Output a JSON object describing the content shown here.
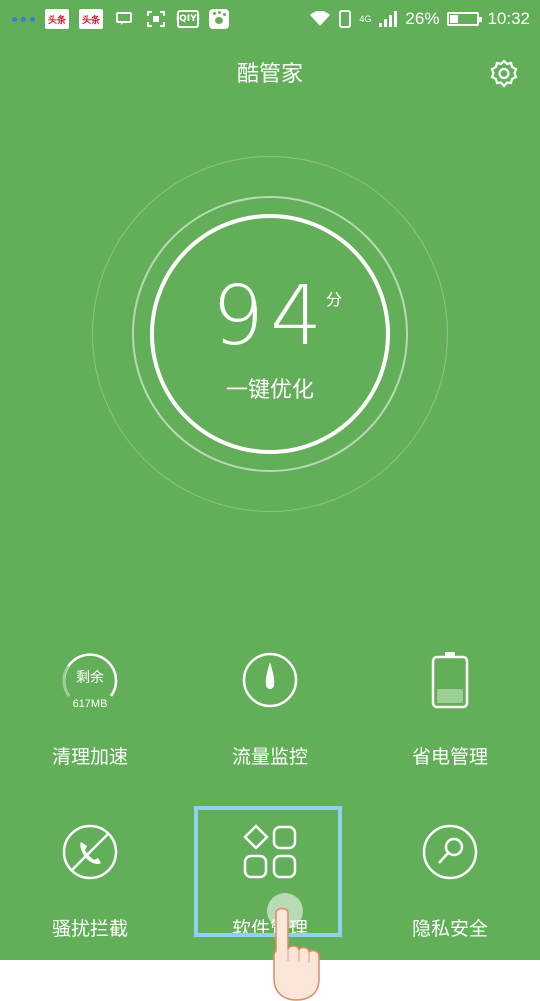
{
  "status_bar": {
    "news1": "头条",
    "news2": "头条",
    "iqiyi": "iQIYI",
    "network": "4G",
    "battery_percent": "26%",
    "battery_level": 0.26,
    "time": "10:32"
  },
  "header": {
    "title": "酷管家"
  },
  "score": {
    "value": "94",
    "unit": "分",
    "action": "一键优化"
  },
  "features": {
    "memory_ring_text": "剩余",
    "memory_size": "617MB",
    "cleanup": "清理加速",
    "traffic": "流量监控",
    "power": "省电管理",
    "block": "骚扰拦截",
    "apps": "软件管理",
    "privacy": "隐私安全"
  },
  "colors": {
    "accent": "#62ae59",
    "highlight": "#8fd2ee"
  }
}
